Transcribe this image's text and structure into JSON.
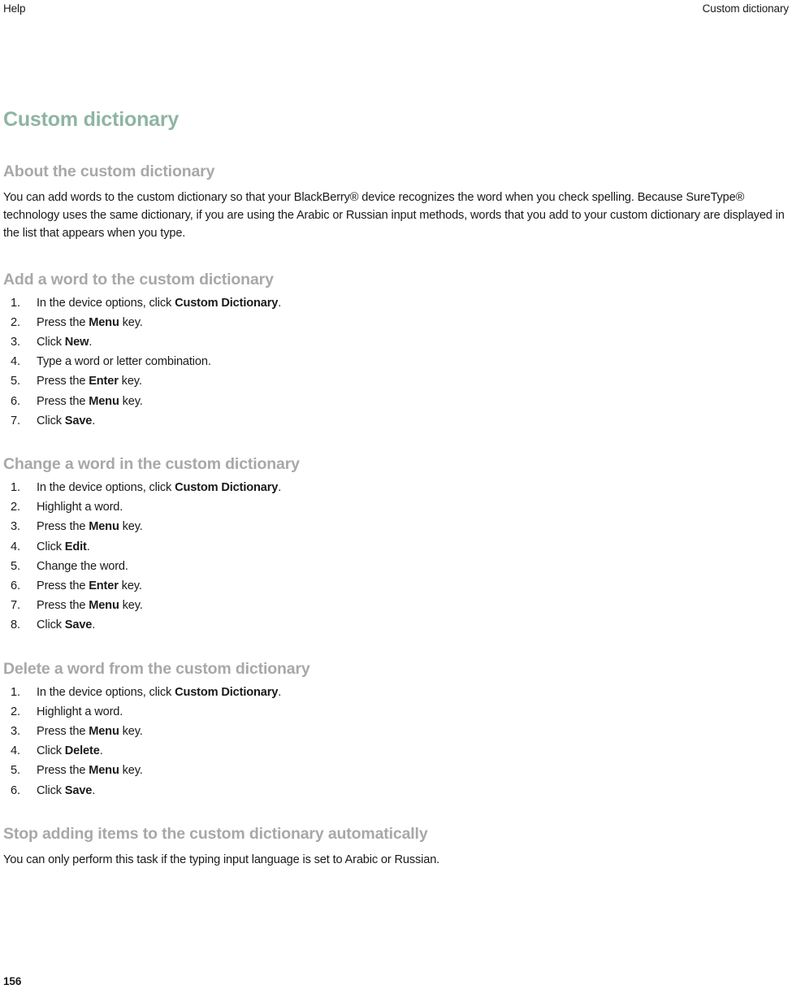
{
  "header": {
    "left": "Help",
    "right": "Custom dictionary"
  },
  "title": "Custom dictionary",
  "sections": [
    {
      "heading": "About the custom dictionary",
      "paragraph": "You can add words to the custom dictionary so that your BlackBerry® device recognizes the word when you check spelling. Because SureType® technology uses the same dictionary, if you are using the Arabic or Russian input methods, words that you add to your custom dictionary are displayed in the list that appears when you type."
    },
    {
      "heading": "Add a word to the custom dictionary",
      "steps": [
        {
          "pre": "In the device options, click ",
          "bold": "Custom Dictionary",
          "post": "."
        },
        {
          "pre": "Press the ",
          "bold": "Menu",
          "post": " key."
        },
        {
          "pre": "Click ",
          "bold": "New",
          "post": "."
        },
        {
          "pre": "Type a word or letter combination.",
          "bold": "",
          "post": ""
        },
        {
          "pre": "Press the ",
          "bold": "Enter",
          "post": " key."
        },
        {
          "pre": "Press the ",
          "bold": "Menu",
          "post": " key."
        },
        {
          "pre": "Click ",
          "bold": "Save",
          "post": "."
        }
      ]
    },
    {
      "heading": "Change a word in the custom dictionary",
      "steps": [
        {
          "pre": "In the device options, click ",
          "bold": "Custom Dictionary",
          "post": "."
        },
        {
          "pre": "Highlight a word.",
          "bold": "",
          "post": ""
        },
        {
          "pre": "Press the ",
          "bold": "Menu",
          "post": " key."
        },
        {
          "pre": "Click ",
          "bold": "Edit",
          "post": "."
        },
        {
          "pre": "Change the word.",
          "bold": "",
          "post": ""
        },
        {
          "pre": "Press the ",
          "bold": "Enter",
          "post": " key."
        },
        {
          "pre": "Press the ",
          "bold": "Menu",
          "post": " key."
        },
        {
          "pre": "Click ",
          "bold": "Save",
          "post": "."
        }
      ]
    },
    {
      "heading": "Delete a word from the custom dictionary",
      "steps": [
        {
          "pre": "In the device options, click ",
          "bold": "Custom Dictionary",
          "post": "."
        },
        {
          "pre": "Highlight a word.",
          "bold": "",
          "post": ""
        },
        {
          "pre": "Press the ",
          "bold": "Menu",
          "post": " key."
        },
        {
          "pre": "Click ",
          "bold": "Delete",
          "post": "."
        },
        {
          "pre": "Press the ",
          "bold": "Menu",
          "post": " key."
        },
        {
          "pre": "Click ",
          "bold": "Save",
          "post": "."
        }
      ]
    },
    {
      "heading": "Stop adding items to the custom dictionary automatically",
      "paragraph": "You can only perform this task if the typing input language is set to Arabic or Russian."
    }
  ],
  "folio": "156",
  "colors": {
    "title": "#8eb5a2",
    "heading": "#a8a8a8",
    "body": "#1a1a1a"
  }
}
